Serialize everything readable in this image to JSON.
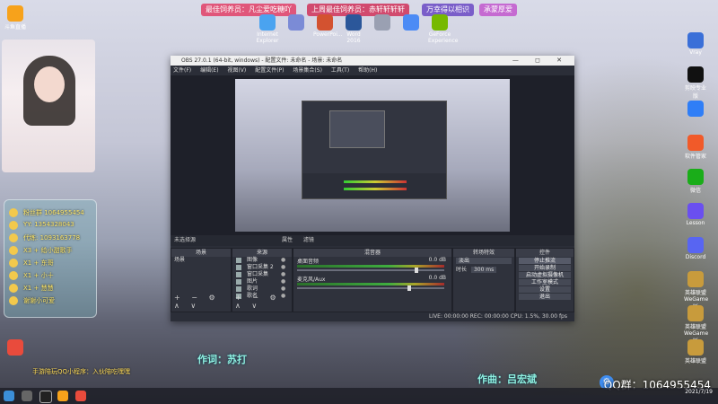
{
  "banners": [
    "最佳饲养员：凡尘爱吃糖吖",
    "上周最佳饲养员：赤轩轩轩轩",
    "万幸得以相识",
    "承蒙厚爱"
  ],
  "desktop_icons_top": [
    {
      "label": "Internet Explorer",
      "color": "#4aa3f0"
    },
    {
      "label": "",
      "color": "#7b8bd6"
    },
    {
      "label": "PowerPoi...",
      "color": "#d35230"
    },
    {
      "label": "Word 2016",
      "color": "#2b579a"
    },
    {
      "label": "",
      "color": "#9aa0b2"
    },
    {
      "label": "",
      "color": "#4c8bf5"
    },
    {
      "label": "GeForce Experience",
      "color": "#76b900"
    }
  ],
  "desktop_icons_right": [
    {
      "label": "Vray",
      "color": "#3a6fd8"
    },
    {
      "label": "剪映专业版",
      "color": "#111111"
    },
    {
      "label": "",
      "color": "#2f7ef7"
    },
    {
      "label": "软件管家",
      "color": "#f15a29"
    },
    {
      "label": "微信",
      "color": "#1aad19"
    },
    {
      "label": "Lesson",
      "color": "#6a4ff0"
    },
    {
      "label": "Discord",
      "color": "#5865f2"
    },
    {
      "label": "英雄联盟 WeGame版",
      "color": "#c89b3c"
    },
    {
      "label": "英雄联盟 WeGame版",
      "color": "#c89b3c"
    },
    {
      "label": "英雄联盟",
      "color": "#c89b3c"
    }
  ],
  "desktop_icons_left": [
    {
      "label": "斗鱼直播",
      "color": "#f7a21b"
    },
    {
      "label": "",
      "color": "#e94b3c"
    }
  ],
  "chat_lines": [
    "粉丝群 1064955454",
    "YY: 1354328043",
    "代练: 1093163778",
    "X3 + 给小甜歌手",
    "X1 + 东哥",
    "X1 + 小十",
    "X1 + 慧慧",
    "谢谢小可爱"
  ],
  "lyrics": {
    "composer_line": "作词：苏打",
    "music_line": "作曲：吕宏斌"
  },
  "qq_group_bar": "手游陪玩QQ小程序：入伙陪吃嘿嘿",
  "obs": {
    "title": "OBS 27.0.1 (64-bit, windows) - 配置文件: 未命名 - 场景: 未命名",
    "menu": [
      "文件(F)",
      "编辑(E)",
      "视图(V)",
      "配置文件(P)",
      "场景集合(S)",
      "工具(T)",
      "帮助(H)"
    ],
    "window_buttons": "— ◻ ✕",
    "subbar": {
      "left": "未选择源",
      "props": "属性",
      "filters": "滤镜"
    },
    "docks": {
      "scenes": {
        "title": "场景",
        "items": [
          "场景"
        ]
      },
      "sources": {
        "title": "来源",
        "items": [
          "图像",
          "窗口采集 2",
          "窗口采集",
          "图片",
          "歌词",
          "歌名"
        ]
      },
      "mixer": {
        "title": "混音器",
        "channels": [
          {
            "name": "桌面音频",
            "db": "0.0 dB",
            "level": 0.8
          },
          {
            "name": "麦克风/Aux",
            "db": "0.0 dB",
            "level": 0.75
          }
        ]
      },
      "transitions": {
        "title": "转场特效",
        "type": "淡出",
        "duration_label": "时长",
        "duration": "300 ms"
      },
      "controls": {
        "title": "控件",
        "buttons": [
          "停止推流",
          "开始录制",
          "启动虚拟摄像机",
          "工作室模式",
          "设置",
          "退出"
        ]
      }
    },
    "status": "LIVE: 00:00:00   REC: 00:00:00   CPU: 1.5%, 30.00 fps"
  },
  "overlay_qq": "QQ群：1064955454",
  "clock": {
    "time": "",
    "date": "2021/7/19"
  },
  "dock_footer": "+ − ⚙ ∧ ∨"
}
